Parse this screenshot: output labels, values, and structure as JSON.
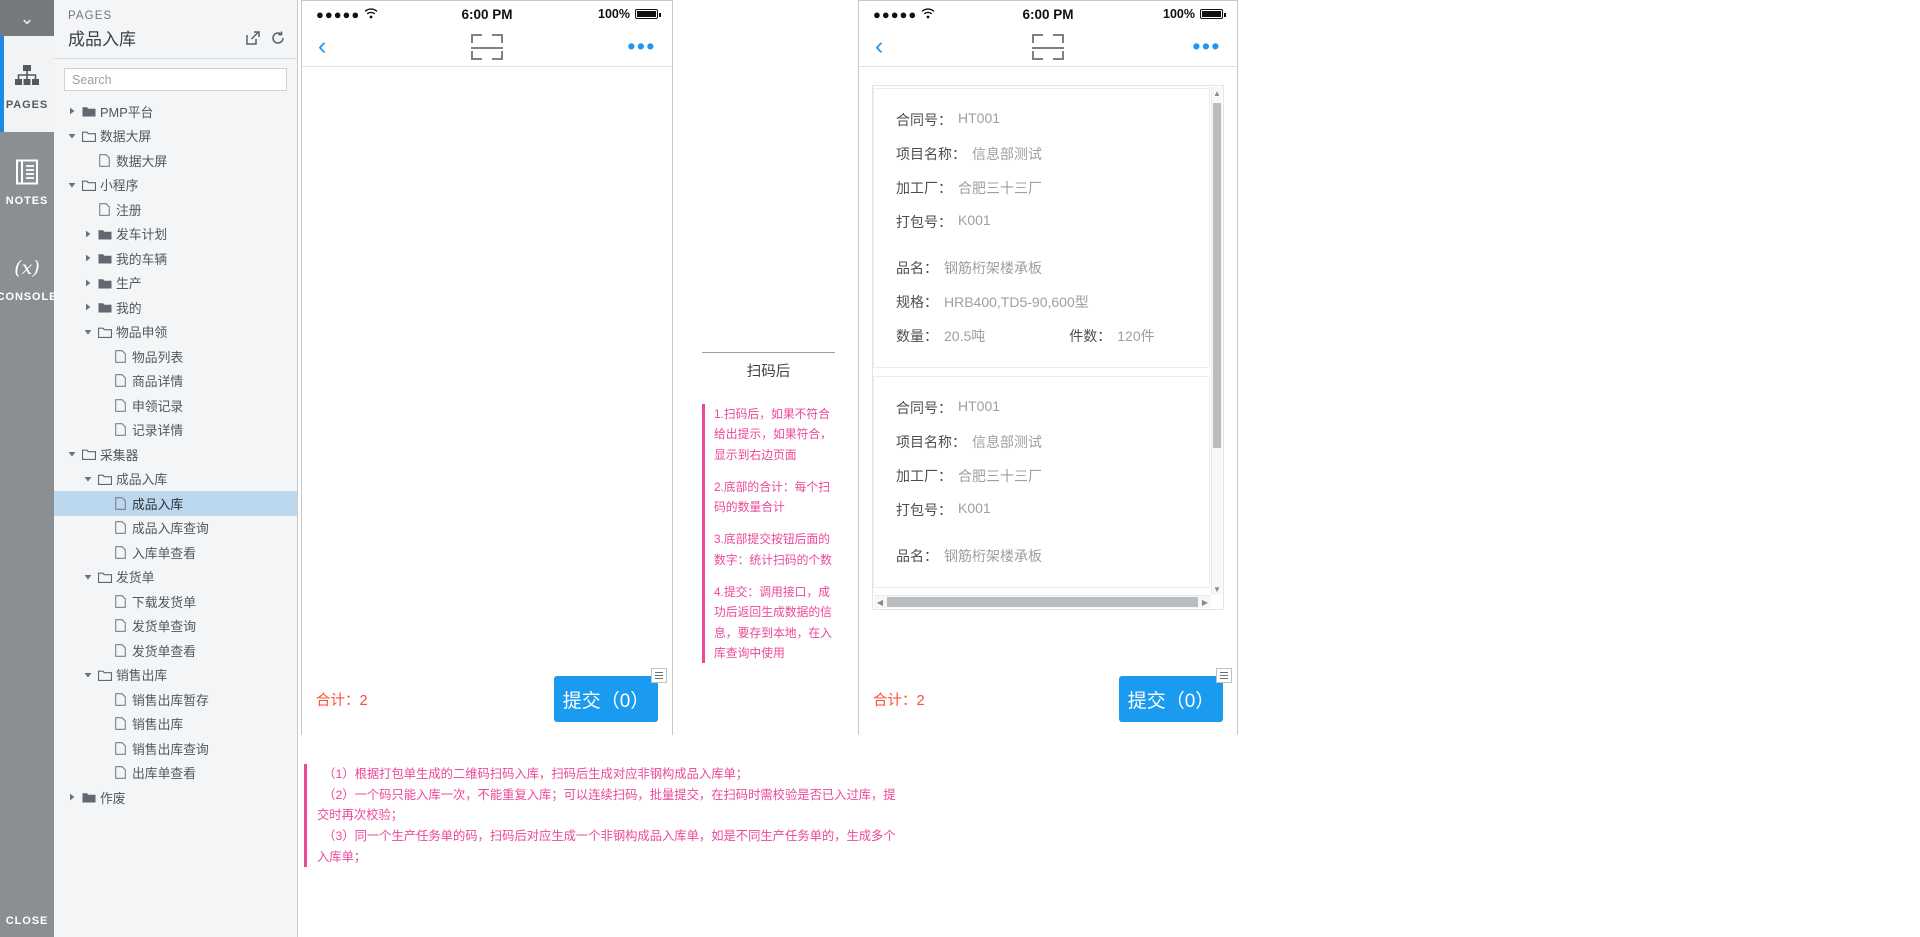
{
  "rail": {
    "collapse_icon": "chevron-down-icon",
    "items": [
      {
        "label": "PAGES",
        "icon": "sitemap-icon",
        "active": true
      },
      {
        "label": "NOTES",
        "icon": "notes-icon",
        "active": false
      },
      {
        "label": "CONSOLE",
        "icon": "console-icon",
        "active": false
      }
    ],
    "close_label": "CLOSE"
  },
  "pages": {
    "kicker": "PAGES",
    "title": "成品入库",
    "actions": [
      {
        "name": "open-in-new-icon"
      },
      {
        "name": "reload-icon"
      }
    ],
    "search": {
      "value": "",
      "placeholder": "Search"
    },
    "tree": [
      {
        "label": "PMP平台",
        "depth": 0,
        "type": "folder",
        "state": "collapsed"
      },
      {
        "label": "数据大屏",
        "depth": 0,
        "type": "folder",
        "state": "expanded"
      },
      {
        "label": "数据大屏",
        "depth": 1,
        "type": "page"
      },
      {
        "label": "小程序",
        "depth": 0,
        "type": "folder",
        "state": "expanded"
      },
      {
        "label": "注册",
        "depth": 1,
        "type": "page"
      },
      {
        "label": "发车计划",
        "depth": 1,
        "type": "folder",
        "state": "collapsed"
      },
      {
        "label": "我的车辆",
        "depth": 1,
        "type": "folder",
        "state": "collapsed"
      },
      {
        "label": "生产",
        "depth": 1,
        "type": "folder",
        "state": "collapsed"
      },
      {
        "label": "我的",
        "depth": 1,
        "type": "folder",
        "state": "collapsed"
      },
      {
        "label": "物品申领",
        "depth": 1,
        "type": "folder",
        "state": "expanded"
      },
      {
        "label": "物品列表",
        "depth": 2,
        "type": "page"
      },
      {
        "label": "商品详情",
        "depth": 2,
        "type": "page"
      },
      {
        "label": "申领记录",
        "depth": 2,
        "type": "page"
      },
      {
        "label": "记录详情",
        "depth": 2,
        "type": "page"
      },
      {
        "label": "采集器",
        "depth": 0,
        "type": "folder",
        "state": "expanded"
      },
      {
        "label": "成品入库",
        "depth": 1,
        "type": "folder",
        "state": "expanded"
      },
      {
        "label": "成品入库",
        "depth": 2,
        "type": "page",
        "selected": true
      },
      {
        "label": "成品入库查询",
        "depth": 2,
        "type": "page"
      },
      {
        "label": "入库单查看",
        "depth": 2,
        "type": "page"
      },
      {
        "label": "发货单",
        "depth": 1,
        "type": "folder",
        "state": "expanded"
      },
      {
        "label": "下载发货单",
        "depth": 2,
        "type": "page"
      },
      {
        "label": "发货单查询",
        "depth": 2,
        "type": "page"
      },
      {
        "label": "发货单查看",
        "depth": 2,
        "type": "page"
      },
      {
        "label": "销售出库",
        "depth": 1,
        "type": "folder",
        "state": "expanded"
      },
      {
        "label": "销售出库暂存",
        "depth": 2,
        "type": "page"
      },
      {
        "label": "销售出库",
        "depth": 2,
        "type": "page"
      },
      {
        "label": "销售出库查询",
        "depth": 2,
        "type": "page"
      },
      {
        "label": "出库单查看",
        "depth": 2,
        "type": "page"
      },
      {
        "label": "作废",
        "depth": 0,
        "type": "folder",
        "state": "collapsed"
      }
    ]
  },
  "phone_left": {
    "statusbar": {
      "signal": "●●●●●",
      "wifi": "wifi-icon",
      "time": "6:00 PM",
      "battery_text": "100%"
    },
    "navbar": {
      "back": "back-chevron-icon",
      "scan": "scan-frame-icon",
      "more": "•••"
    },
    "footer": {
      "total_label": "合计：2",
      "submit_label": "提交（0）"
    }
  },
  "phone_right": {
    "statusbar": {
      "signal": "●●●●●",
      "wifi": "wifi-icon",
      "time": "6:00 PM",
      "battery_text": "100%"
    },
    "navbar": {
      "back": "back-chevron-icon",
      "scan": "scan-frame-icon",
      "more": "•••"
    },
    "cards": [
      {
        "rows": [
          {
            "k": "合同号：",
            "v": "HT001"
          },
          {
            "k": "项目名称：",
            "v": "信息部测试"
          },
          {
            "k": "加工厂：",
            "v": "合肥三十三厂"
          },
          {
            "k": "打包号：",
            "v": "K001"
          },
          {
            "k": "品名：",
            "v": "钢筋桁架楼承板",
            "gap": true
          },
          {
            "k": "规格：",
            "v": "HRB400,TD5-90,600型"
          }
        ],
        "pair": {
          "k1": "数量：",
          "v1": "20.5吨",
          "k2": "件数：",
          "v2": "120件"
        }
      },
      {
        "rows": [
          {
            "k": "合同号：",
            "v": "HT001"
          },
          {
            "k": "项目名称：",
            "v": "信息部测试"
          },
          {
            "k": "加工厂：",
            "v": "合肥三十三厂"
          },
          {
            "k": "打包号：",
            "v": "K001"
          },
          {
            "k": "品名：",
            "v": "钢筋桁架楼承板",
            "gap": true
          }
        ]
      }
    ],
    "footer": {
      "total_label": "合计：2",
      "submit_label": "提交（0）"
    }
  },
  "notes": {
    "middle": {
      "title": "扫码后",
      "items": [
        "1.扫码后，如果不符合给出提示，如果符合，显示到右边页面",
        "2.底部的合计：每个扫码的数量合计",
        "3.底部提交按钮后面的数字：统计扫码的个数",
        "4.提交：调用接口，成功后返回生成数据的信息，要存到本地，在入库查询中使用"
      ]
    },
    "bottom": {
      "lines": [
        "（1）根据打包单生成的二维码扫码入库，扫码后生成对应非钢构成品入库单；",
        "（2）一个码只能入库一次，不能重复入库；可以连续扫码，批量提交，在扫码时需校验是否已入过库，提交时再次校验；",
        "（3）同一个生产任务单的码，扫码后对应生成一个非钢构成品入库单，如是不同生产任务单的，生成多个入库单；"
      ]
    }
  },
  "colors": {
    "accent_blue": "#1b9bf0",
    "note_pink": "#ec4899",
    "total_red": "#ff4d3a",
    "selection_blue": "#bcd8ee",
    "rail_gray": "#8a8f94"
  }
}
